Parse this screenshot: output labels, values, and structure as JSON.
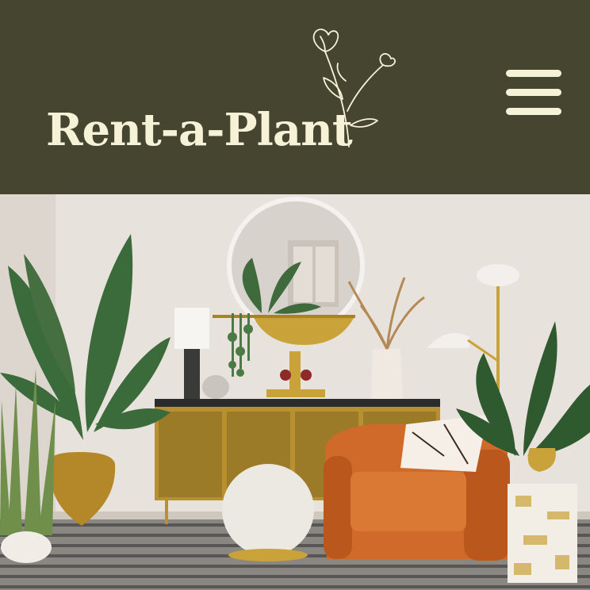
{
  "header": {
    "logo_text": "Rent-a-Plant",
    "logo_icon": "flower-line-icon",
    "menu_icon": "hamburger-menu-icon"
  },
  "hero": {
    "image_description_icon": "living-room-plants-image"
  },
  "colors": {
    "header_bg": "#454530",
    "logo_text": "#f6f2d7",
    "accent_gold": "#c9a23a",
    "armchair_orange": "#cf6a2a"
  }
}
